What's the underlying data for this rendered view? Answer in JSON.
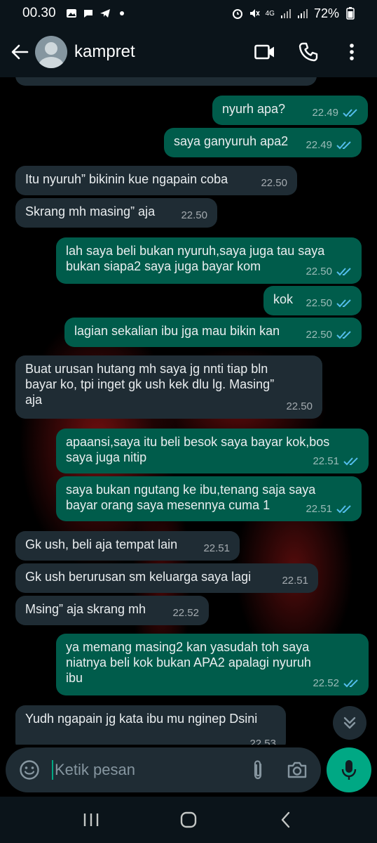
{
  "status_bar": {
    "time": "00.30",
    "network": "4G",
    "battery": "72%"
  },
  "header": {
    "contact_name": "kampret"
  },
  "messages": [
    {
      "dir": "out",
      "text": "nyurh apa?",
      "time": "22.49",
      "read": true
    },
    {
      "dir": "out",
      "text": "saya ganyuruh apa2",
      "time": "22.49",
      "read": true
    },
    {
      "dir": "in",
      "text": "Itu nyuruh” bikinin kue ngapain coba",
      "time": "22.50"
    },
    {
      "dir": "in",
      "text": "Skrang mh masing” aja",
      "time": "22.50"
    },
    {
      "dir": "out",
      "text": "lah saya beli bukan nyuruh,saya juga tau saya\nbukan siapa2 saya juga bayar kom",
      "time": "22.50",
      "read": true
    },
    {
      "dir": "out",
      "text": "kok",
      "time": "22.50",
      "read": true
    },
    {
      "dir": "out",
      "text": "lagian sekalian ibu jga mau bikin kan",
      "time": "22.50",
      "read": true
    },
    {
      "dir": "in",
      "text": "Buat urusan hutang mh saya jg nnti tiap bln\nbayar ko, tpi inget gk ush kek dlu lg. Masing”\naja",
      "time": "22.50"
    },
    {
      "dir": "out",
      "text": "apaansi,saya itu beli besok saya bayar kok,bos\nsaya juga nitip",
      "time": "22.51",
      "read": true
    },
    {
      "dir": "out",
      "text": "saya bukan ngutang ke ibu,tenang saja saya\nbayar orang saya mesennya cuma 1",
      "time": "22.51",
      "read": true
    },
    {
      "dir": "in",
      "text": "Gk ush, beli aja tempat lain",
      "time": "22.51"
    },
    {
      "dir": "in",
      "text": "Gk ush berurusan sm keluarga saya lagi",
      "time": "22.51"
    },
    {
      "dir": "in",
      "text": "Msing” aja skrang mh",
      "time": "22.52"
    },
    {
      "dir": "out",
      "text": "ya memang masing2 kan yasudah toh saya\nniatnya beli kok bukan APA2 apalagi nyuruh\nibu",
      "time": "22.52",
      "read": true
    },
    {
      "dir": "in",
      "text": "Yudh ngapain jg kata ibu mu nginep Dsini",
      "time": "22.53"
    }
  ],
  "input": {
    "placeholder": "Ketik pesan"
  },
  "colors": {
    "incoming_bubble": "#1f2c34",
    "outgoing_bubble": "#005c4b",
    "accent": "#00a884",
    "read_tick": "#53bdeb"
  }
}
